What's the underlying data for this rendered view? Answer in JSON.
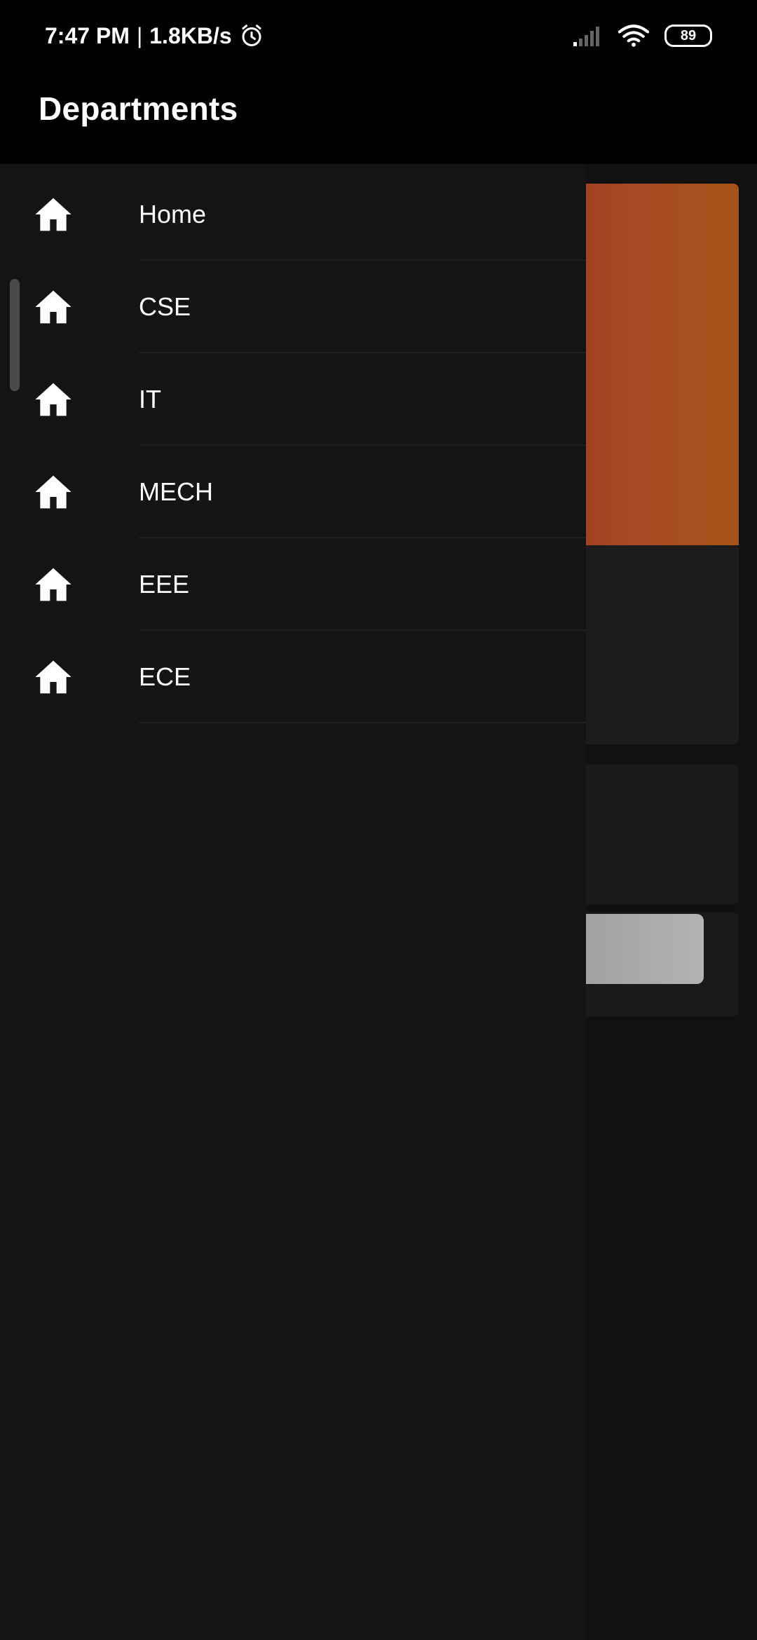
{
  "status_bar": {
    "time": "7:47 PM",
    "separator": "|",
    "network_speed": "1.8KB/s",
    "battery": "89",
    "icons": [
      "alarm-icon",
      "signal-icon",
      "wifi-icon",
      "battery-icon"
    ]
  },
  "app_bar": {
    "title": "Departments"
  },
  "drawer": {
    "items": [
      {
        "label": "Home",
        "icon": "home-icon"
      },
      {
        "label": "CSE",
        "icon": "home-icon"
      },
      {
        "label": "IT",
        "icon": "home-icon"
      },
      {
        "label": "MECH",
        "icon": "home-icon"
      },
      {
        "label": "EEE",
        "icon": "home-icon"
      },
      {
        "label": "ECE",
        "icon": "home-icon"
      }
    ]
  },
  "colors": {
    "status_bar_bg": "#000000",
    "app_bar_bg": "#000000",
    "drawer_bg": "#141414",
    "hero_card": "#a84a25"
  }
}
